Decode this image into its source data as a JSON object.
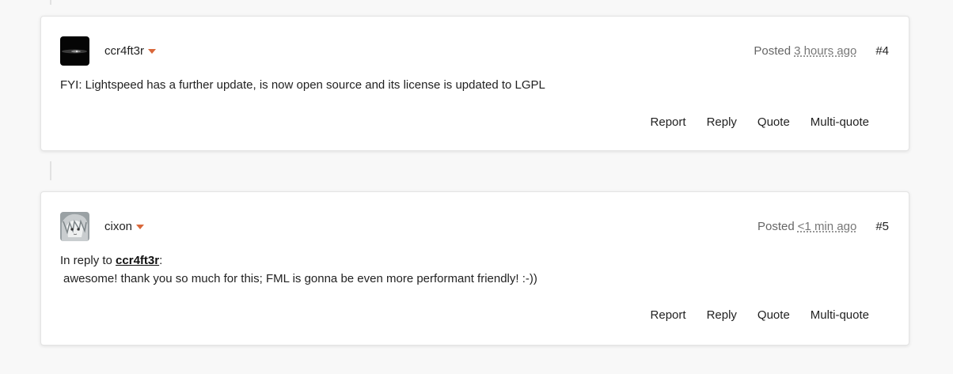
{
  "posts": [
    {
      "author": "ccr4ft3r",
      "posted_label": "Posted",
      "posted_ago": "3 hours ago",
      "number": "#4",
      "body": "FYI: Lightspeed has a further update, is now open source and its license is updated to LGPL",
      "actions": [
        "Report",
        "Reply",
        "Quote",
        "Multi-quote"
      ]
    },
    {
      "author": "cixon",
      "posted_label": "Posted",
      "posted_ago": "<1 min ago",
      "number": "#5",
      "reply_prefix": "In reply to ",
      "reply_user": "ccr4ft3r",
      "reply_suffix": ":",
      "body": "awesome! thank you so much for this; FML is gonna be even more performant friendly! :-))",
      "actions": [
        "Report",
        "Reply",
        "Quote",
        "Multi-quote"
      ]
    }
  ],
  "colors": {
    "accent": "#d9673a",
    "background": "#f8f8f8",
    "card": "#ffffff"
  }
}
